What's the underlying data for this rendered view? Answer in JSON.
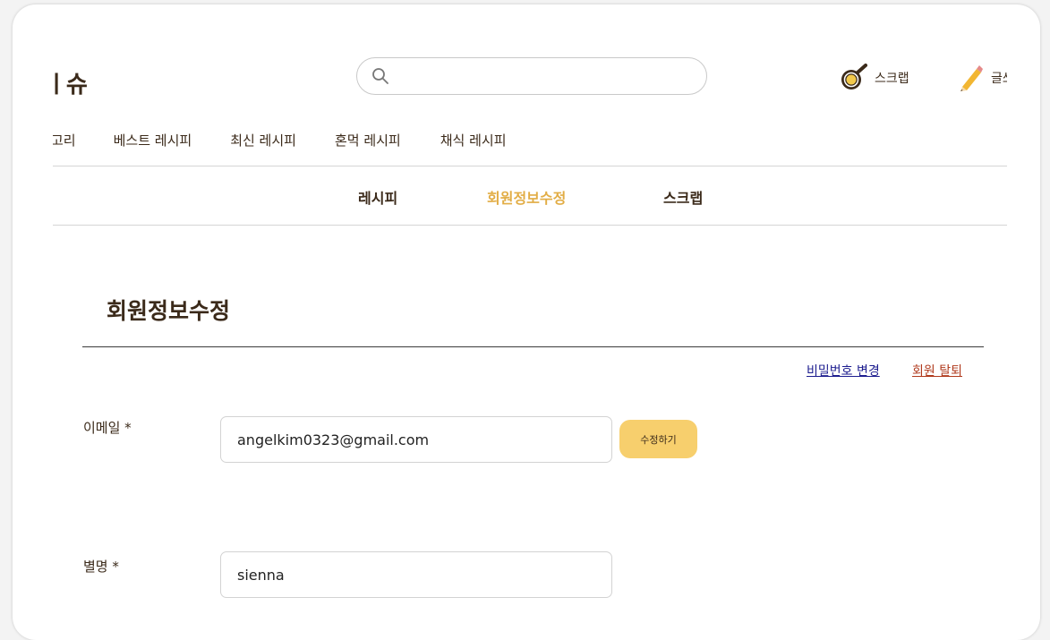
{
  "header": {
    "logo_text": "ㅣ슈",
    "search": {
      "value": "",
      "placeholder": ""
    },
    "scrap_label": "스크랩",
    "write_label": "글쓰"
  },
  "category_nav": [
    {
      "label": "고리"
    },
    {
      "label": "베스트 레시피"
    },
    {
      "label": "최신 레시피"
    },
    {
      "label": "혼먹 레시피"
    },
    {
      "label": "채식 레시피"
    }
  ],
  "mypage_tabs": [
    {
      "label": "레시피",
      "active": false
    },
    {
      "label": "회원정보수정",
      "active": true
    },
    {
      "label": "스크랩",
      "active": false
    }
  ],
  "page": {
    "title": "회원정보수정",
    "change_password_link": "비밀번호 변경",
    "withdraw_link": "회원 탈퇴"
  },
  "form": {
    "email": {
      "label": "이메일 *",
      "value": "angelkim0323@gmail.com",
      "edit_button": "수정하기"
    },
    "nickname": {
      "label": "별명 *",
      "value": "sienna"
    }
  },
  "colors": {
    "brand_dark": "#3b2a1a",
    "accent": "#e2ad45",
    "button_yellow": "#f7cf6d",
    "withdraw_red": "#b03a1d",
    "link_blue": "#1d1d8f"
  },
  "icons": [
    "search-icon",
    "scrap-frying-pan-icon",
    "pencil-icon"
  ]
}
